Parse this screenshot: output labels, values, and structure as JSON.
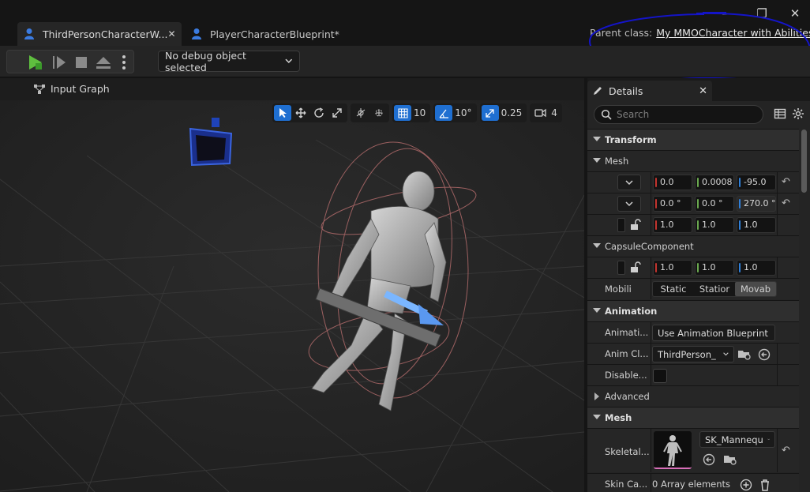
{
  "tabs": [
    {
      "label": "ThirdPersonCharacterW...",
      "close": "✕"
    },
    {
      "label": "PlayerCharacterBlueprint*"
    }
  ],
  "window_controls": {
    "minimize": "—",
    "restore": "❐",
    "close": "✕"
  },
  "parent_class": {
    "label": "Parent class:",
    "value": "My MMOCharacter with Abilities"
  },
  "toolbar": {
    "debug_object": "No debug object selected"
  },
  "viewport": {
    "header_label": "Input Graph",
    "grid_snap": "10",
    "rotation_snap": "10°",
    "scale_snap": "0.25",
    "camera_speed": "4"
  },
  "details": {
    "title": "Details",
    "close": "✕",
    "search_placeholder": "Search",
    "transform": {
      "category": "Transform",
      "mesh_label": "Mesh",
      "location": {
        "x": "0.0",
        "y": "0.0008",
        "z": "-95.0"
      },
      "rotation": {
        "x": "0.0 °",
        "y": "0.0 °",
        "z": "270.0 °"
      },
      "scale": {
        "x": "1.0",
        "y": "1.0",
        "z": "1.0"
      },
      "capsule_label": "CapsuleComponent",
      "capsule_scale": {
        "x": "1.0",
        "y": "1.0",
        "z": "1.0"
      },
      "mobility_label": "Mobili",
      "mobility_options": [
        "Static",
        "Statior",
        "Movab"
      ],
      "mobility_selected": "Movab"
    },
    "animation": {
      "category": "Animation",
      "mode_label": "Animati...",
      "mode_value": "Use Animation Blueprint",
      "class_label": "Anim Cl...",
      "class_value": "ThirdPerson_",
      "disable_label": "Disable...",
      "disable_checked": false,
      "advanced_label": "Advanced"
    },
    "mesh": {
      "category": "Mesh",
      "skeletal_label": "Skeletal...",
      "skeletal_value": "SK_Mannequ",
      "skin_label": "Skin Ca...",
      "skin_value": "0 Array elements"
    }
  },
  "colors": {
    "accent_blue": "#1f6fd1",
    "play_green": "#5fbf3f",
    "axis_x": "#c3342e",
    "axis_y": "#6aa84f",
    "axis_z": "#2f7fd8",
    "annotation": "#1414c8"
  }
}
